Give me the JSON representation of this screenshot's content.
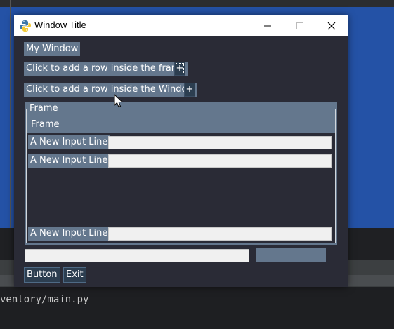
{
  "window": {
    "title": "Window Title"
  },
  "main": {
    "heading": "My Window",
    "add_frame_label": "Click to add a row inside the frame",
    "add_frame_button": "+",
    "add_window_label": "Click to add a row inside the Window",
    "add_window_button": "+"
  },
  "frame": {
    "legend": "Frame",
    "header": "Frame",
    "rows": [
      {
        "label": "A New Input Line",
        "value": ""
      },
      {
        "label": "A New Input Line",
        "value": ""
      },
      {
        "label": "A New Input Line",
        "value": ""
      }
    ]
  },
  "bottom": {
    "input_value": "",
    "button_label": "Button",
    "exit_label": "Exit"
  },
  "editor": {
    "path_text": "ventory/main.py"
  },
  "colors": {
    "window_bg": "#2a2b36",
    "label_bg": "#64778d",
    "button_bg": "#2c3e50",
    "desktop_blue": "#2452a6"
  }
}
